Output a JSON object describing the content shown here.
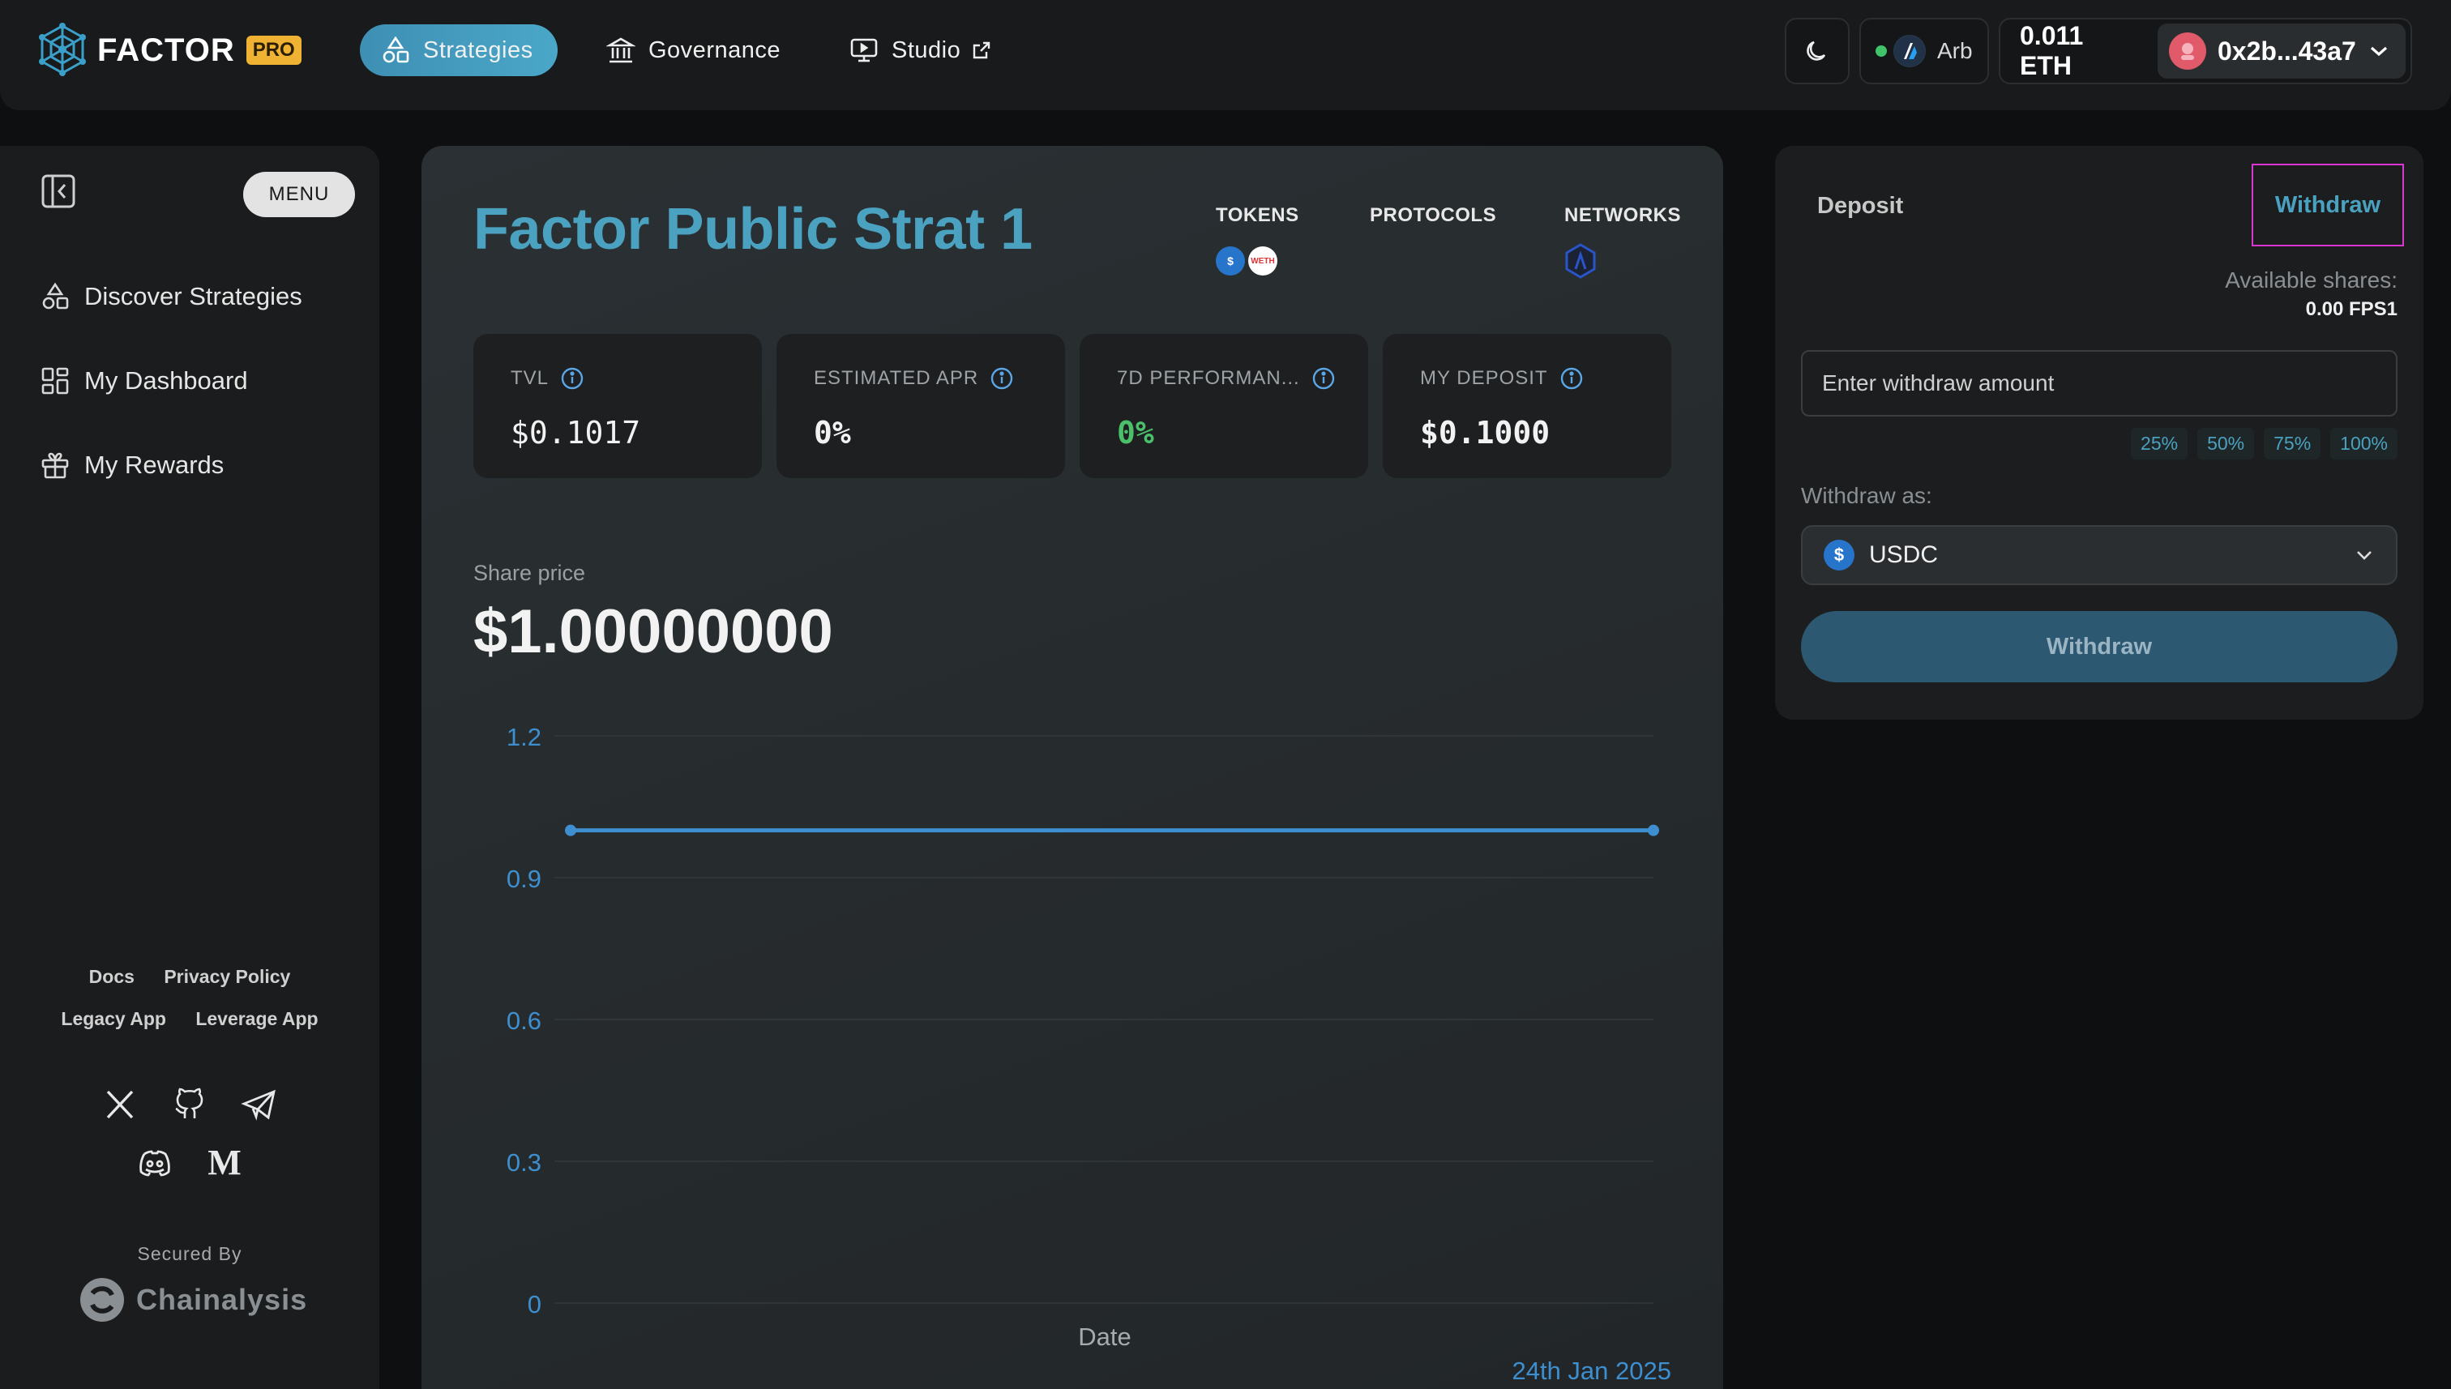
{
  "app": {
    "brand": "FACTOR",
    "badge": "PRO"
  },
  "nav": {
    "strategies": "Strategies",
    "governance": "Governance",
    "studio": "Studio"
  },
  "topbar": {
    "network": "Arb",
    "eth_balance": "0.011 ETH",
    "address": "0x2b...43a7"
  },
  "sidebar": {
    "menu": "MENU",
    "items": [
      {
        "label": "Discover Strategies",
        "icon": "shapes-icon"
      },
      {
        "label": "My Dashboard",
        "icon": "dashboard-icon"
      },
      {
        "label": "My Rewards",
        "icon": "gift-icon"
      }
    ],
    "links_row1": [
      "Docs",
      "Privacy Policy"
    ],
    "links_row2": [
      "Legacy App",
      "Leverage App"
    ],
    "secured_by": "Secured By",
    "security_partner": "Chainalysis"
  },
  "strategy": {
    "title": "Factor Public Strat 1",
    "tokens_label": "TOKENS",
    "protocols_label": "PROTOCOLS",
    "networks_label": "NETWORKS",
    "token_icons": [
      "USDC",
      "WETH"
    ],
    "stats": [
      {
        "label": "TVL",
        "value": "$0.1017"
      },
      {
        "label": "ESTIMATED APR",
        "value": "0%"
      },
      {
        "label": "7D PERFORMAN...",
        "value": "0%"
      },
      {
        "label": "MY DEPOSIT",
        "value": "$0.1000"
      }
    ],
    "share_price_label": "Share price",
    "share_price": "$1.00000000"
  },
  "chart_data": {
    "type": "line",
    "xlabel": "Date",
    "ylabel": "",
    "x": [
      "",
      "24th Jan 2025"
    ],
    "y_ticks": [
      "0",
      "0.3",
      "0.6",
      "0.9",
      "1.2"
    ],
    "ylim": [
      0,
      1.2
    ],
    "series": [
      {
        "values": [
          1.0,
          1.0
        ]
      }
    ],
    "x_tick_label": "24th Jan 2025",
    "colors": {
      "line": "#3d8fd0",
      "ticks": "#3d8fd0"
    }
  },
  "panel": {
    "tab_deposit": "Deposit",
    "tab_withdraw": "Withdraw",
    "available_label": "Available shares:",
    "available_value": "0.00 FPS1",
    "input_placeholder": "Enter withdraw amount",
    "percentages": [
      "25%",
      "50%",
      "75%",
      "100%"
    ],
    "withdraw_as_label": "Withdraw as:",
    "withdraw_as_value": "USDC",
    "withdraw_button": "Withdraw"
  }
}
